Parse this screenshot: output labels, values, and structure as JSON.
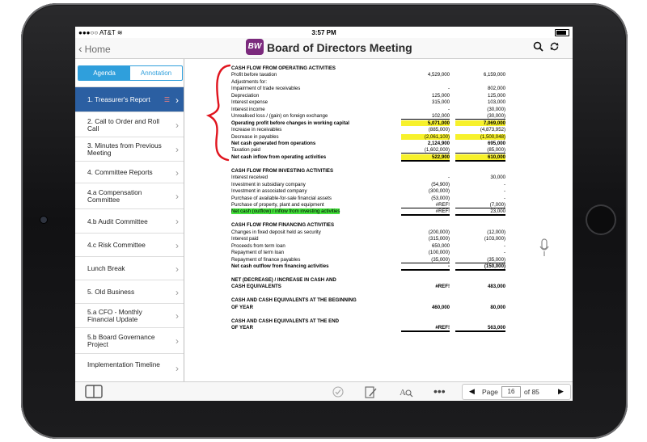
{
  "status": {
    "carrier": "AT&T",
    "time": "3:57 PM",
    "battery": ""
  },
  "nav": {
    "back_label": "Home",
    "logo_text": "BW",
    "title": "Board of Directors Meeting"
  },
  "tabs": [
    {
      "label": "Agenda",
      "active": true
    },
    {
      "label": "Annotation",
      "active": false
    }
  ],
  "agenda": [
    {
      "label": "1. Treasurer's Report",
      "selected": true
    },
    {
      "label": "2. Call to Order and Roll Call"
    },
    {
      "label": "3. Minutes from Previous Meeting"
    },
    {
      "label": "4. Committee Reports"
    },
    {
      "label": "4.a Compensation Committee"
    },
    {
      "label": "4.b Audit Committee"
    },
    {
      "label": "4.c Risk Committee"
    },
    {
      "label": "Lunch Break"
    },
    {
      "label": "5. Old Business"
    },
    {
      "label": "5.a CFO - Monthly Financial Update"
    },
    {
      "label": "5.b Board Governance Project"
    },
    {
      "label": "Implementation Timeline"
    }
  ],
  "doc": {
    "rows": [
      {
        "label": "CASH FLOW FROM OPERATING ACTIVITIES",
        "v1": "",
        "v2": "",
        "bold": true
      },
      {
        "label": "Profit before taxation",
        "v1": "4,529,000",
        "v2": "6,159,000"
      },
      {
        "label": "Adjustments for:",
        "v1": "",
        "v2": ""
      },
      {
        "label": "Impairment of trade receivables",
        "v1": "-",
        "v2": "802,000"
      },
      {
        "label": "Depreciation",
        "v1": "125,000",
        "v2": "125,000"
      },
      {
        "label": "Interest expense",
        "v1": "315,000",
        "v2": "103,000"
      },
      {
        "label": "Interest income",
        "v1": "-",
        "v2": "(30,000)"
      },
      {
        "label": "Unrealised loss / (gain) on foreign exchange",
        "v1": "102,000",
        "v2": "(30,000)"
      },
      {
        "label": "Operating profit before changes in working capital",
        "v1": "5,071,000",
        "v2": "7,069,000",
        "bold": true,
        "hl": true
      },
      {
        "label": "Increase in receivables",
        "v1": "(885,000)",
        "v2": "(4,873,952)"
      },
      {
        "label": "Decrease in payables",
        "v1": "(2,061,100)",
        "v2": "(1,500,048)",
        "hl": true
      },
      {
        "label": "Net cash generated from operations",
        "v1": "2,124,900",
        "v2": "695,000",
        "bold": true
      },
      {
        "label": "Taxation paid",
        "v1": "(1,602,000)",
        "v2": "(85,000)"
      },
      {
        "label": "Net cash  inflow from operating activities",
        "v1": "522,900",
        "v2": "610,000",
        "bold": true,
        "hl": true
      },
      {
        "label": "",
        "v1": "",
        "v2": ""
      },
      {
        "label": "CASH FLOW FROM INVESTING ACTIVITIES",
        "v1": "",
        "v2": "",
        "bold": true
      },
      {
        "label": "Interest received",
        "v1": "-",
        "v2": "30,000"
      },
      {
        "label": "Investment in subsidiary company",
        "v1": "(54,900)",
        "v2": "-"
      },
      {
        "label": "Investment in associated company",
        "v1": "(300,000)",
        "v2": "-"
      },
      {
        "label": "Purchase of available-for-sale financial assets",
        "v1": "(53,000)",
        "v2": "-"
      },
      {
        "label": "Purchase of property, plant and equipment",
        "v1": "#REF!",
        "v2": "(7,000)"
      },
      {
        "label": "Net cash (outflow) / inflow from investing activities",
        "v1": "#REF!",
        "v2": "23,000",
        "green": true
      },
      {
        "label": "",
        "v1": "",
        "v2": ""
      },
      {
        "label": "CASH FLOW FROM FINANCING ACTIVITIES",
        "v1": "",
        "v2": "",
        "bold": true
      },
      {
        "label": "Changes in fixed deposit held as security",
        "v1": "(200,000)",
        "v2": "(12,000)"
      },
      {
        "label": "Interest paid",
        "v1": "(315,000)",
        "v2": "(103,000)"
      },
      {
        "label": "Proceeds from term loan",
        "v1": "650,000",
        "v2": "-"
      },
      {
        "label": "Repayment of term loan",
        "v1": "(100,000)",
        "v2": "-"
      },
      {
        "label": "Repayment of finance payables",
        "v1": "(35,000)",
        "v2": "(35,000)"
      },
      {
        "label": "Net cash outflow from financing activities",
        "v1": "-",
        "v2": "(150,000)",
        "bold": true
      },
      {
        "label": "",
        "v1": "",
        "v2": ""
      },
      {
        "label": "NET (DECREASE) / INCREASE IN CASH AND",
        "v1": "",
        "v2": "",
        "bold": true
      },
      {
        "label": "     CASH EQUIVALENTS",
        "v1": "#REF!",
        "v2": "483,000",
        "bold": true
      },
      {
        "label": "",
        "v1": "",
        "v2": ""
      },
      {
        "label": "CASH AND CASH EQUIVALENTS AT THE BEGINNING",
        "v1": "",
        "v2": "",
        "bold": true
      },
      {
        "label": "     OF YEAR",
        "v1": "460,000",
        "v2": "80,000",
        "bold": true
      },
      {
        "label": "",
        "v1": "",
        "v2": ""
      },
      {
        "label": "CASH AND CASH EQUIVALENTS AT THE END",
        "v1": "",
        "v2": "",
        "bold": true
      },
      {
        "label": "     OF YEAR",
        "v1": "#REF!",
        "v2": "563,000",
        "bold": true
      }
    ]
  },
  "pager": {
    "label": "Page",
    "current": "16",
    "total_label": "of 85"
  },
  "colors": {
    "accent": "#2f9fdc",
    "selected": "#2b5fa2",
    "logo": "#7b2a7d",
    "highlight": "#f7f12b",
    "green": "#43e03b",
    "annotation": "#e0141e"
  }
}
